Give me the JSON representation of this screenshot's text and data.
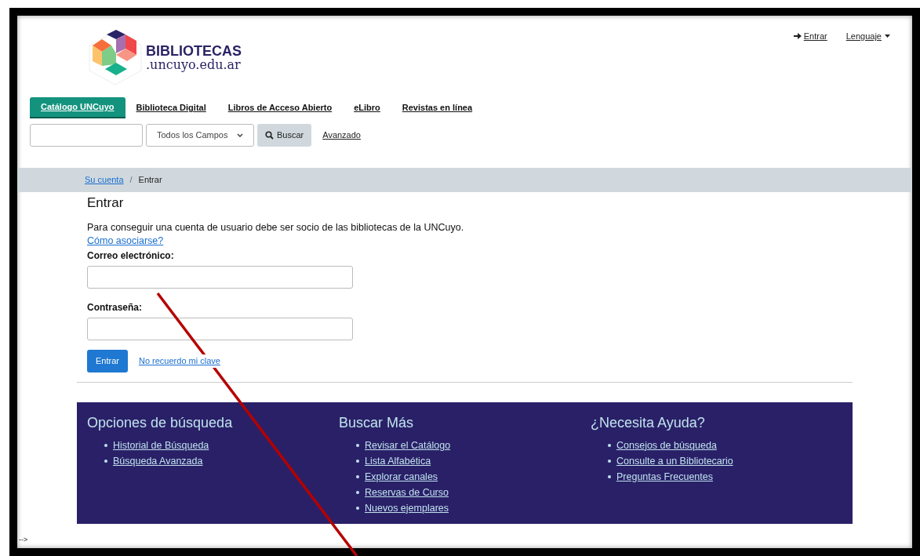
{
  "logo": {
    "title": "BIBLIOTECAS",
    "subtitle": ".uncuyo.edu.ar"
  },
  "header_links": [
    {
      "kind": "login",
      "label": "Entrar"
    },
    {
      "kind": "menu",
      "label": "Lenguaje"
    }
  ],
  "tabs": [
    {
      "label": "Catálogo UNCuyo",
      "selected": true
    },
    {
      "label": "Biblioteca Digital",
      "selected": false
    },
    {
      "label": "Libros de Acceso Abierto",
      "selected": false
    },
    {
      "label": "eLibro",
      "selected": false
    },
    {
      "label": "Revistas en línea",
      "selected": false
    }
  ],
  "search": {
    "scope": "Todos los Campos",
    "button": "Buscar",
    "advanced": "Avanzado"
  },
  "breadcrumb_separator": "/",
  "breadcrumb": [
    {
      "label": "Su cuenta",
      "link": true
    },
    {
      "label": "Entrar",
      "link": false
    }
  ],
  "login": {
    "title": "Entrar",
    "intro": "Para conseguir una cuenta de usuario debe ser socio de las bibliotecas de la UNCuyo.",
    "intro_link": "Cómo asociarse?",
    "email_label": "Correo electrónico:",
    "password_label": "Contraseña:",
    "submit": "Entrar",
    "forgot": "No recuerdo mi clave"
  },
  "footer": [
    {
      "title": "Opciones de búsqueda",
      "links": [
        "Historial de Búsqueda",
        "Búsqueda Avanzada"
      ]
    },
    {
      "title": "Buscar Más",
      "links": [
        "Revisar el Catálogo",
        "Lista Alfabética",
        "Explorar canales",
        "Reservas de Curso",
        "Nuevos ejemplares"
      ]
    },
    {
      "title": "¿Necesita Ayuda?",
      "links": [
        "Consejos de búsqueda",
        "Consulte a un Bibliotecario",
        "Preguntas Frecuentes"
      ]
    }
  ],
  "stray_text": "-->"
}
